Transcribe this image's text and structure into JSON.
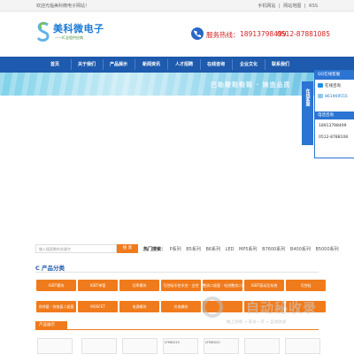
{
  "topbar": {
    "welcome": "欢迎光临美科微电子网站！",
    "links": [
      "手机网站",
      "|",
      "网站地图",
      "|",
      "RSS"
    ]
  },
  "header": {
    "logo_title": "美科微电子",
    "logo_sub": "——IC全程供应商",
    "phone_label": "服务热线：",
    "phone1": "18913798499",
    "phone2": "0512-87881085",
    "brand_color": "#1e5aad"
  },
  "nav": {
    "items": [
      "首页",
      "关于我们",
      "产品展示",
      "新闻资讯",
      "人才招聘",
      "在线咨询",
      "企业文化",
      "联系我们"
    ]
  },
  "banner": {
    "slogan": "巴勒鞭鞋鞍鞘 · 铸造品质"
  },
  "qq_panel": {
    "tab_label": "在线客服",
    "head": "QQ在线客服",
    "online_label": "在线咨询",
    "qq_number": "861969555",
    "phone_head": "电话咨询",
    "phone1": "18913798499",
    "phone2": "0512-8788108"
  },
  "search": {
    "placeholder": "输入搜索数的关键字",
    "button": "搜 索",
    "hot_label": "热门搜索：",
    "hot_items": [
      "P系列",
      "B5系列",
      "B6系列",
      "LED",
      "MP5系列",
      "B7600系列",
      "B400系列",
      "B5000系列"
    ]
  },
  "categories": {
    "title": "产品分类",
    "items": [
      "IGBT模块",
      "IGBT单管",
      "功率模块",
      "可控硅半控半控 - 全控",
      "整流二极管 - 电流整流二极管",
      "IGBT驱动及系统",
      "可控硅",
      "肖特基 - 快恢复二极管",
      "MOSFET",
      "电源模块",
      "光电耦合",
      "",
      "",
      ""
    ]
  },
  "products": {
    "tab": "产品展示",
    "items": [
      "LTM8019",
      "LTM8022",
      "",
      "",
      "",
      "",
      ""
    ]
  },
  "watermark": {
    "title": "自动秘收录",
    "sub": "做上链接 → 来访一次 → 自动收录"
  }
}
